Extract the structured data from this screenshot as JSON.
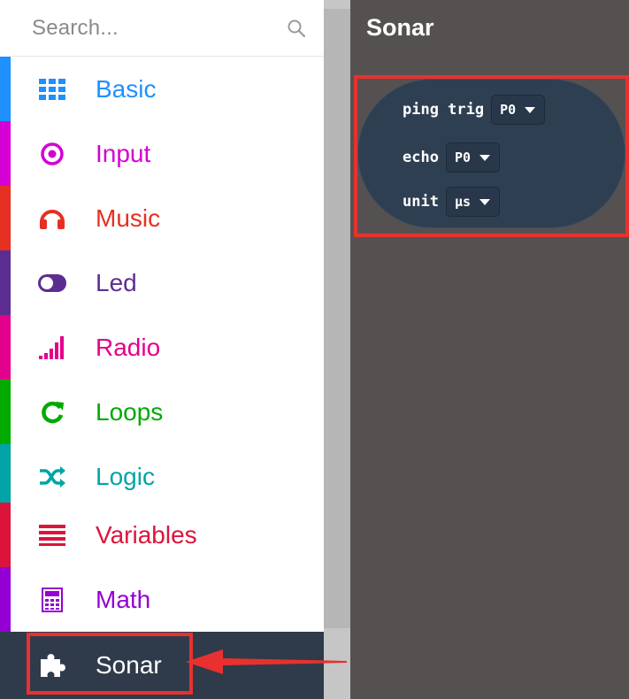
{
  "search": {
    "placeholder": "Search..."
  },
  "categories": [
    {
      "label": "Basic",
      "color": "#1e90ff",
      "icon": "grid-icon"
    },
    {
      "label": "Input",
      "color": "#d400d4",
      "icon": "radio-target-icon"
    },
    {
      "label": "Music",
      "color": "#e63022",
      "icon": "headphones-icon"
    },
    {
      "label": "Led",
      "color": "#5c2d91",
      "icon": "toggle-icon"
    },
    {
      "label": "Radio",
      "color": "#e3008c",
      "icon": "signal-bars-icon"
    },
    {
      "label": "Loops",
      "color": "#00aa00",
      "icon": "refresh-icon"
    },
    {
      "label": "Logic",
      "color": "#00a4a6",
      "icon": "shuffle-icon"
    },
    {
      "label": "Variables",
      "color": "#dc143c",
      "icon": "list-lines-icon"
    },
    {
      "label": "Math",
      "color": "#9400d3",
      "icon": "calculator-icon"
    },
    {
      "label": "Sonar",
      "color": "#2f3b4a",
      "icon": "puzzle-icon"
    }
  ],
  "flyout": {
    "title": "Sonar",
    "block": {
      "row1_label": "ping trig",
      "row1_value": "P0",
      "row2_label": "echo",
      "row2_value": "P0",
      "row3_label": "unit",
      "row3_value": "μs"
    }
  },
  "colors": {
    "selected_bg": "#2f3b4a",
    "flyout_bg": "#565151",
    "block_bg": "#2f3f52",
    "annotation_red": "#e8312f"
  }
}
